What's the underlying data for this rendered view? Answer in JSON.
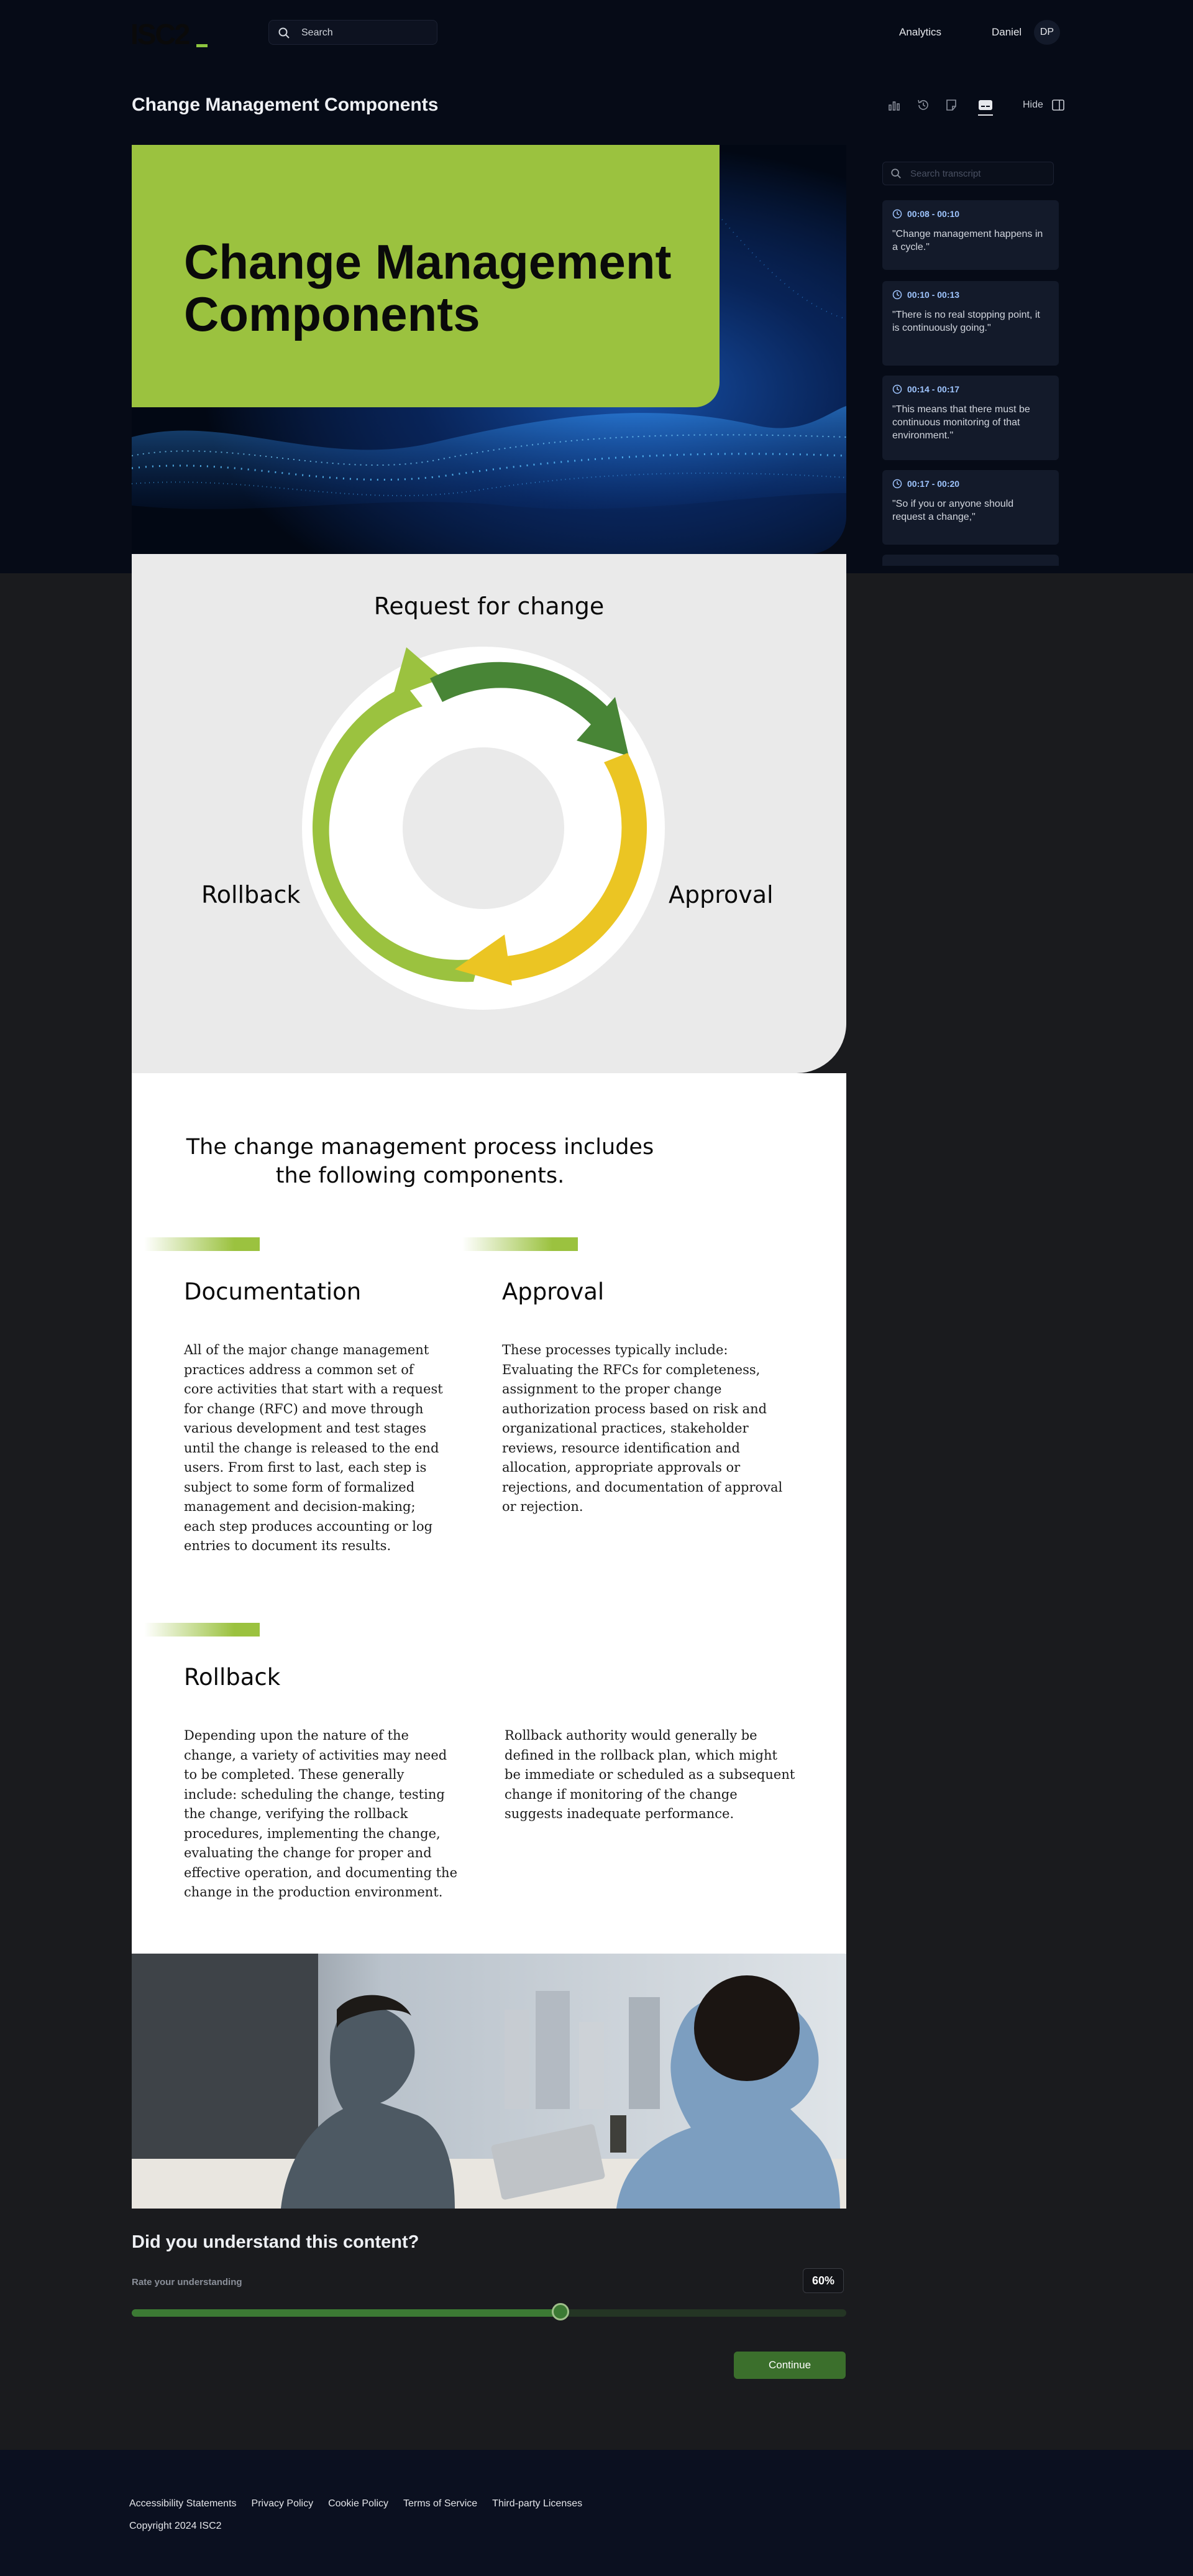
{
  "header": {
    "logo_text": "ISC2",
    "search_placeholder": "Search",
    "analytics": "Analytics",
    "user_name": "Daniel",
    "user_initials": "DP"
  },
  "page": {
    "title": "Change Management Components",
    "hide_label": "Hide"
  },
  "transcript": {
    "search_placeholder": "Search transcript",
    "items": [
      {
        "time": "00:08 - 00:10",
        "text": "\"Change management happens in a cycle.\""
      },
      {
        "time": "00:10 - 00:13",
        "text": "\"There is no real stopping point, it is continuously going.\""
      },
      {
        "time": "00:14 - 00:17",
        "text": "\"This means that there must be continuous monitoring of that environment.\""
      },
      {
        "time": "00:17 - 00:20",
        "text": "\"So if you or anyone should request a change,\""
      }
    ]
  },
  "hero": {
    "title": "Change Management Components"
  },
  "diagram": {
    "top_label": "Request for change",
    "left_label": "Rollback",
    "right_label": "Approval",
    "colors": {
      "dark_green": "#488536",
      "yellow": "#ebc523",
      "light_green": "#9bc23f"
    }
  },
  "content": {
    "intro": "The change management process includes the following components.",
    "documentation": {
      "heading": "Documentation",
      "body": "All of the major change management practices address a common set of core activities that start with a request for change (RFC) and move through various development and test stages until the change is released to the end users. From first to last, each step is subject to some form of formalized management and decision-making; each step produces accounting or log entries to document its results."
    },
    "approval": {
      "heading": "Approval",
      "body": "These processes typically include: Evaluating the RFCs for completeness, assignment to the proper change authorization process based on risk and organizational practices, stakeholder reviews, resource identification and allocation, appropriate approvals or rejections, and documentation of approval or rejection."
    },
    "rollback": {
      "heading": "Rollback",
      "body1": "Depending upon the nature of the change, a variety of activities may need to be completed. These generally include: scheduling the change, testing the change, verifying the rollback procedures, implementing the change, evaluating the change for proper and effective operation, and documenting the change in the production environment.",
      "body2": "Rollback authority would generally be defined in the rollback plan, which might be immediate or scheduled as a subsequent change if monitoring of the change suggests inadequate performance."
    }
  },
  "understanding": {
    "question": "Did you understand this content?",
    "rate_label": "Rate your understanding",
    "percent_text": "60%",
    "value": 0.6,
    "continue_label": "Continue"
  },
  "footer": {
    "links": [
      "Accessibility Statements",
      "Privacy Policy",
      "Cookie Policy",
      "Terms of Service",
      "Third-party Licenses"
    ],
    "copyright": "Copyright 2024 ISC2"
  }
}
